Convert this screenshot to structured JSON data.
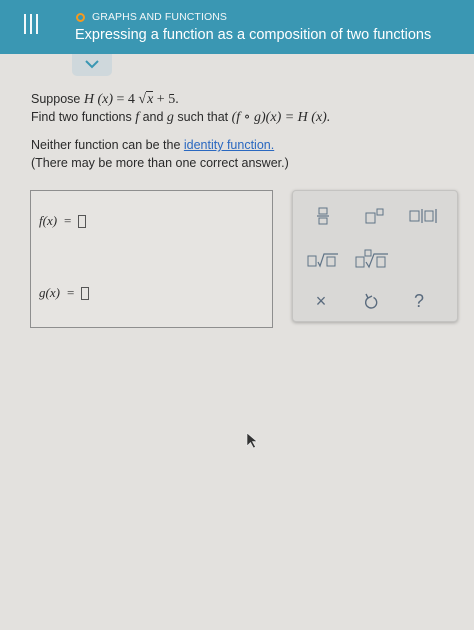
{
  "header": {
    "topic": "GRAPHS AND FUNCTIONS",
    "title": "Expressing a function as a composition of two functions",
    "status_color": "#f39a21",
    "bar_color": "#3a97b3"
  },
  "problem": {
    "suppose_prefix": "Suppose ",
    "H_x": "H (x)",
    "equals_four": " = 4 ",
    "radicand": "x",
    "plus_five": " + 5.",
    "find_prefix": "Find two functions ",
    "f": "f",
    "and": " and ",
    "g": "g",
    "such_that": " such that ",
    "composition": "(f ∘ g)(x) = H (x).",
    "neither_prefix": "Neither function can be the ",
    "identity_link": "identity function.",
    "note": "(There may be more than one correct answer.)"
  },
  "answers": {
    "f_label": "f(x)",
    "g_label": "g(x)",
    "equals": "="
  },
  "palette": {
    "icons": [
      "fraction-icon",
      "exponent-icon",
      "absolute-value-icon",
      "square-root-icon",
      "nth-root-icon",
      "clear-icon",
      "undo-icon",
      "help-icon"
    ],
    "clear_label": "×",
    "help_label": "?"
  }
}
